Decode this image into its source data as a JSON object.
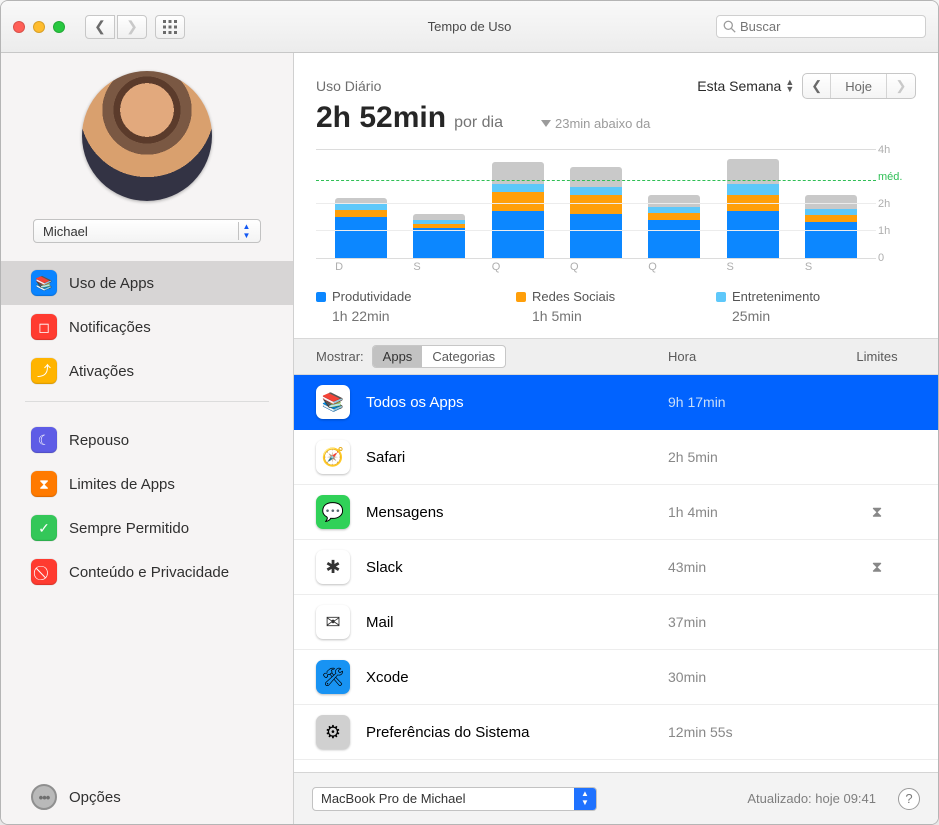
{
  "window": {
    "title": "Tempo de Uso",
    "search_placeholder": "Buscar"
  },
  "sidebar": {
    "user_name": "Michael",
    "items": [
      {
        "label": "Uso de Apps",
        "icon": "layers",
        "color": "#0a84ff",
        "selected": true
      },
      {
        "label": "Notificações",
        "icon": "bell",
        "color": "#ff3b30",
        "selected": false
      },
      {
        "label": "Ativações",
        "icon": "pickup",
        "color": "#ffb400",
        "selected": false
      }
    ],
    "items2": [
      {
        "label": "Repouso",
        "icon": "moon",
        "color": "#5e5ce6"
      },
      {
        "label": "Limites de Apps",
        "icon": "timer",
        "color": "#ff7a00"
      },
      {
        "label": "Sempre Permitido",
        "icon": "check",
        "color": "#34c759"
      },
      {
        "label": "Conteúdo e Privacidade",
        "icon": "nope",
        "color": "#ff3b30"
      }
    ],
    "options_label": "Opções"
  },
  "header": {
    "title": "Uso Diário",
    "range_label": "Esta Semana",
    "nav_mid": "Hoje",
    "value": "2h 52min",
    "value_suffix": "por dia",
    "delta": "23min abaixo da"
  },
  "chart_data": {
    "type": "bar",
    "ylim_hours": 4,
    "avg_hours": 2.87,
    "y_ticks": [
      "4h",
      "méd.",
      "2h",
      "1h",
      "0"
    ],
    "categories": [
      "D",
      "S",
      "Q",
      "Q",
      "Q",
      "S",
      "S"
    ],
    "series_order": [
      "prod",
      "soc",
      "ent",
      "other"
    ],
    "series_labels": {
      "prod": "Produtividade",
      "soc": "Redes Sociais",
      "ent": "Entretenimento"
    },
    "series_colors": {
      "prod": "#0c87ff",
      "soc": "#ff9f0a",
      "ent": "#5ec8fa",
      "other": "#c9c9c9"
    },
    "bars": [
      {
        "prod": 1.5,
        "soc": 0.25,
        "ent": 0.2,
        "other": 0.25
      },
      {
        "prod": 1.1,
        "soc": 0.15,
        "ent": 0.15,
        "other": 0.2
      },
      {
        "prod": 1.7,
        "soc": 0.7,
        "ent": 0.3,
        "other": 0.8
      },
      {
        "prod": 1.6,
        "soc": 0.7,
        "ent": 0.3,
        "other": 0.7
      },
      {
        "prod": 1.4,
        "soc": 0.25,
        "ent": 0.2,
        "other": 0.45
      },
      {
        "prod": 1.7,
        "soc": 0.6,
        "ent": 0.4,
        "other": 0.9
      },
      {
        "prod": 1.3,
        "soc": 0.25,
        "ent": 0.25,
        "other": 0.5
      }
    ],
    "legend": [
      {
        "key": "prod",
        "label": "Produtividade",
        "value": "1h 22min"
      },
      {
        "key": "soc",
        "label": "Redes Sociais",
        "value": "1h 5min"
      },
      {
        "key": "ent",
        "label": "Entretenimento",
        "value": "25min"
      }
    ]
  },
  "filter": {
    "label": "Mostrar:",
    "seg_apps": "Apps",
    "seg_cats": "Categorias",
    "col_time": "Hora",
    "col_limits": "Limites"
  },
  "apps": [
    {
      "name": "Todos os Apps",
      "time": "9h 17min",
      "limit": false,
      "selected": true,
      "icon": "layers",
      "icon_bg": "#ffffff"
    },
    {
      "name": "Safari",
      "time": "2h 5min",
      "limit": false,
      "selected": false,
      "icon": "safari",
      "icon_bg": "#ffffff"
    },
    {
      "name": "Mensagens",
      "time": "1h 4min",
      "limit": true,
      "selected": false,
      "icon": "msg",
      "icon_bg": "#30d158"
    },
    {
      "name": "Slack",
      "time": "43min",
      "limit": true,
      "selected": false,
      "icon": "slack",
      "icon_bg": "#ffffff"
    },
    {
      "name": "Mail",
      "time": "37min",
      "limit": false,
      "selected": false,
      "icon": "mail",
      "icon_bg": "#ffffff"
    },
    {
      "name": "Xcode",
      "time": "30min",
      "limit": false,
      "selected": false,
      "icon": "xcode",
      "icon_bg": "#1893f3"
    },
    {
      "name": "Preferências do Sistema",
      "time": "12min 55s",
      "limit": false,
      "selected": false,
      "icon": "gear",
      "icon_bg": "#d0d0d0"
    }
  ],
  "footer": {
    "device": "MacBook Pro de Michael",
    "updated": "Atualizado: hoje 09:41"
  },
  "glyphs": {
    "layers": "📚",
    "bell": "◻︎",
    "pickup": "⤴︎",
    "moon": "☾",
    "timer": "⧗",
    "check": "✓",
    "nope": "⃠",
    "safari": "🧭",
    "msg": "💬",
    "slack": "✱",
    "mail": "✉︎",
    "xcode": "🛠",
    "gear": "⚙︎",
    "hourglass": "⧗"
  }
}
